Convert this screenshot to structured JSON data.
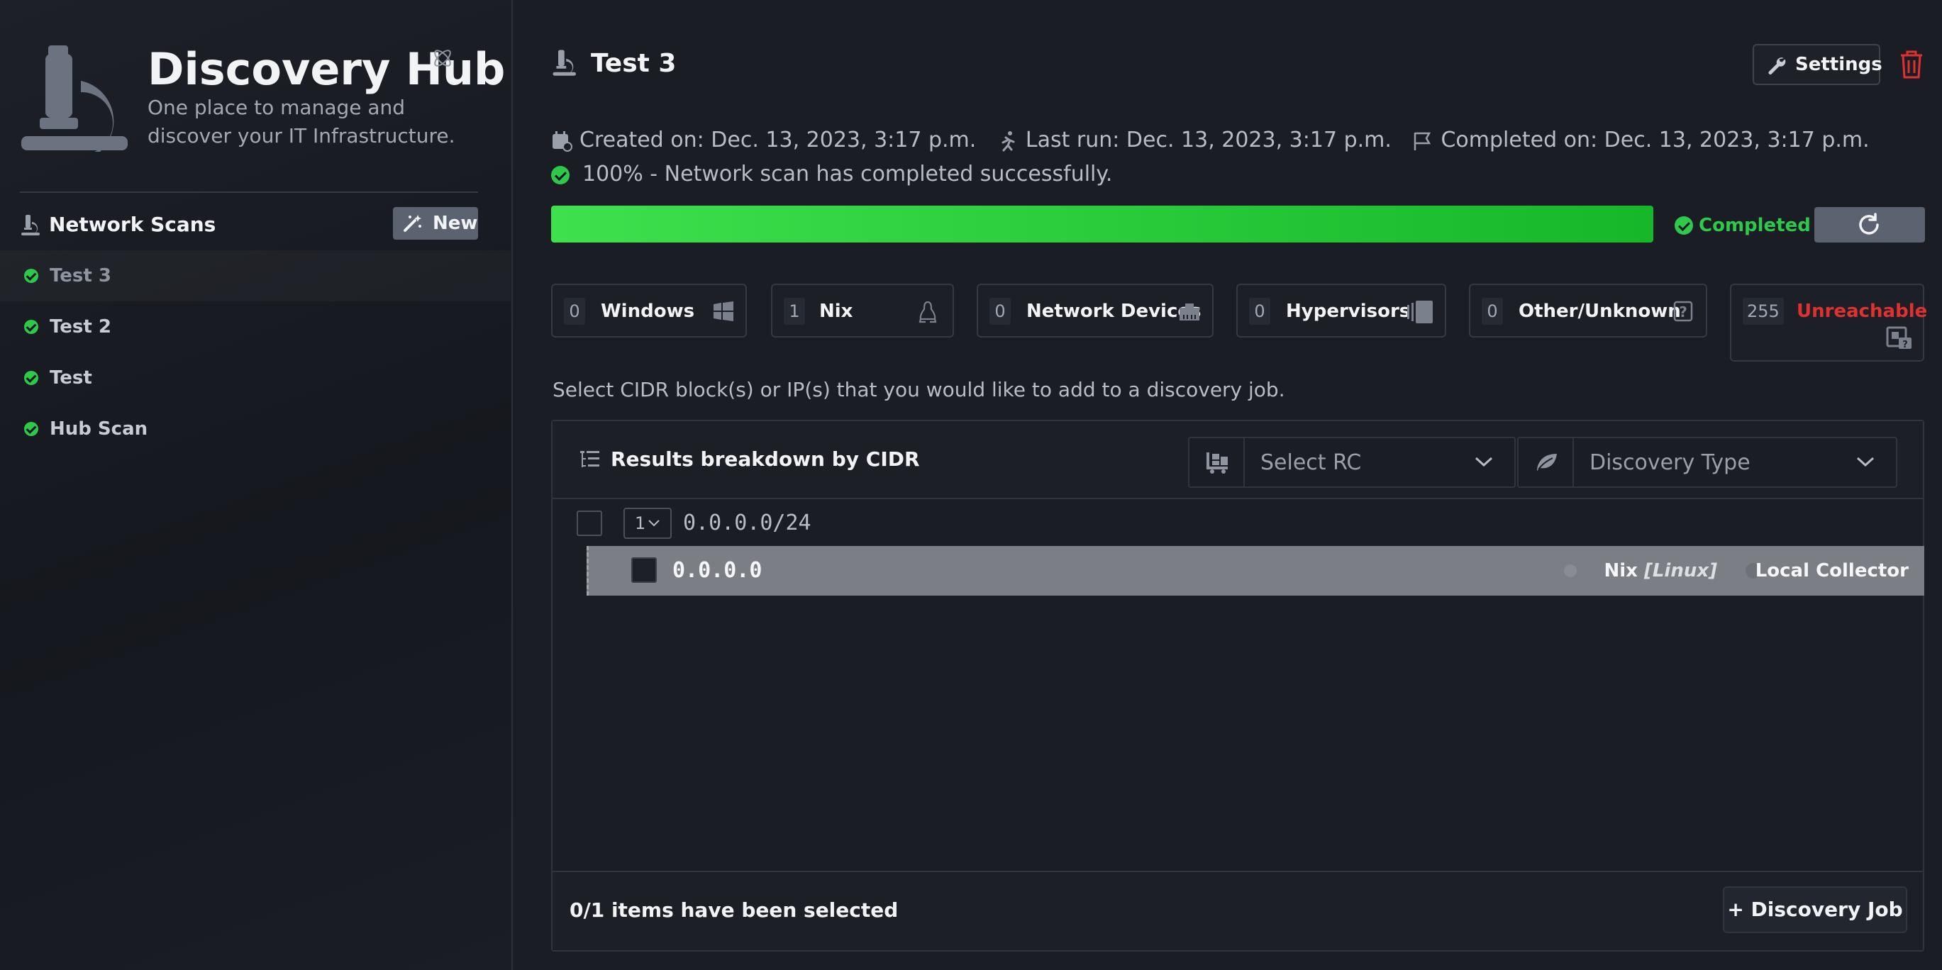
{
  "brand": {
    "title": "Discovery Hub",
    "subtitle": "One place to manage and discover your IT Infrastructure.",
    "icon": "microscope-icon",
    "beta_icon": "atom-icon"
  },
  "sidebar": {
    "section_title": "Network Scans",
    "new_button": "New",
    "scans": [
      {
        "label": "Test 3",
        "status": "completed",
        "active": true
      },
      {
        "label": "Test 2",
        "status": "completed",
        "active": false
      },
      {
        "label": "Test",
        "status": "completed",
        "active": false
      },
      {
        "label": "Hub Scan",
        "status": "completed",
        "active": false
      }
    ]
  },
  "header": {
    "title": "Test 3",
    "settings_label": "Settings"
  },
  "meta": {
    "created": "Created on: Dec. 13, 2023, 3:17 p.m.",
    "last_run": "Last run: Dec. 13, 2023, 3:17 p.m.",
    "completed": "Completed on: Dec. 13, 2023, 3:17 p.m.",
    "status_message": "100% - Network scan has completed successfully."
  },
  "progress": {
    "percent": 100,
    "status_label": "Completed"
  },
  "counts": [
    {
      "count": "0",
      "label": "Windows",
      "icon": "windows-icon"
    },
    {
      "count": "1",
      "label": "Nix",
      "icon": "linux-icon"
    },
    {
      "count": "0",
      "label": "Network Devices",
      "icon": "ethernet-icon"
    },
    {
      "count": "0",
      "label": "Hypervisors",
      "icon": "server-icon"
    },
    {
      "count": "0",
      "label": "Other/Unknown",
      "icon": "question-icon"
    },
    {
      "count": "255",
      "label": "Unreachable",
      "icon": "unreachable-icon"
    }
  ],
  "hint": "Select CIDR block(s) or IP(s) that you would like to add to a discovery job.",
  "results": {
    "title": "Results breakdown by CIDR",
    "select_rc_placeholder": "Select RC",
    "discovery_type_placeholder": "Discovery Type",
    "cidr": {
      "toggle": "1",
      "value": "0.0.0.0/24"
    },
    "hosts": [
      {
        "ip": "0.0.0.0",
        "os": "Nix",
        "os_detail": "[Linux]",
        "collector": "Local Collector"
      }
    ],
    "selection_text": "0/1 items have been selected",
    "discovery_job_button": "+ Discovery Job"
  },
  "colors": {
    "success": "#2ec84a",
    "danger": "#e03131",
    "background": "#1a1d24"
  }
}
